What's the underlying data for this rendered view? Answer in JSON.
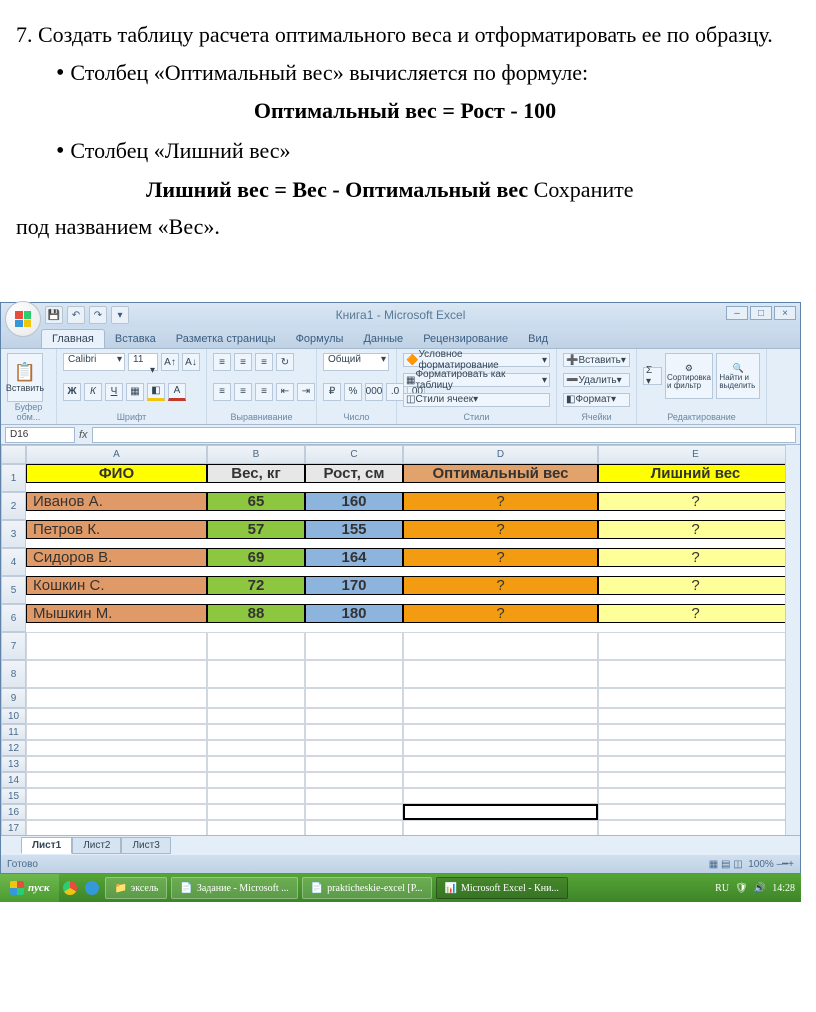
{
  "doc": {
    "para1": "7.   Создать   таблицу   расчета   оптимального   веса     и отформатировать ее по образцу.",
    "bullet1": "Столбец «Оптимальный вес» вычисляется по формуле:",
    "formula1": "Оптимальный вес = Рост - 100",
    "bullet2": "Столбец «Лишний вес»",
    "formula2_pre": "Лишний вес = Вес - Оптимальный вес",
    "formula2_post": " Сохраните",
    "line_last": "под названием «Вес»."
  },
  "excel": {
    "title": "Книга1 - Microsoft Excel",
    "tabs": [
      "Главная",
      "Вставка",
      "Разметка страницы",
      "Формулы",
      "Данные",
      "Рецензирование",
      "Вид"
    ],
    "groups": {
      "clipboard": "Буфер обм...",
      "font": "Шрифт",
      "align": "Выравнивание",
      "number": "Число",
      "styles": "Стили",
      "cells": "Ячейки",
      "edit": "Редактирование"
    },
    "buttons": {
      "paste": "Вставить",
      "font_name": "Calibri",
      "font_size": "11",
      "number_fmt": "Общий",
      "cond_fmt": "Условное форматирование",
      "as_table": "Форматировать как таблицу",
      "cell_styles": "Стили ячеек",
      "insert": "Вставить",
      "delete": "Удалить",
      "format": "Формат",
      "sort": "Сортировка и фильтр",
      "find": "Найти и выделить"
    },
    "namebox": "D16",
    "headers": [
      "A",
      "B",
      "C",
      "D",
      "E"
    ],
    "row1": {
      "a": "ФИО",
      "b": "Вес, кг",
      "c": "Рост, см",
      "d": "Оптимальный вес",
      "e": "Лишний вес"
    },
    "data": [
      {
        "a": "Иванов А.",
        "b": "65",
        "c": "160",
        "d": "?",
        "e": "?"
      },
      {
        "a": "Петров К.",
        "b": "57",
        "c": "155",
        "d": "?",
        "e": "?"
      },
      {
        "a": "Сидоров В.",
        "b": "69",
        "c": "164",
        "d": "?",
        "e": "?"
      },
      {
        "a": "Кошкин С.",
        "b": "72",
        "c": "170",
        "d": "?",
        "e": "?"
      },
      {
        "a": "Мышкин М.",
        "b": "88",
        "c": "180",
        "d": "?",
        "e": "?"
      }
    ],
    "sheets": [
      "Лист1",
      "Лист2",
      "Лист3"
    ],
    "status": "Готово",
    "zoom": "100%"
  },
  "taskbar": {
    "start": "пуск",
    "items": [
      "эксель",
      "Задание - Microsoft ...",
      "prakticheskie-excel [Р...",
      "Microsoft Excel - Кни..."
    ],
    "lang": "RU",
    "time": "14:28"
  }
}
